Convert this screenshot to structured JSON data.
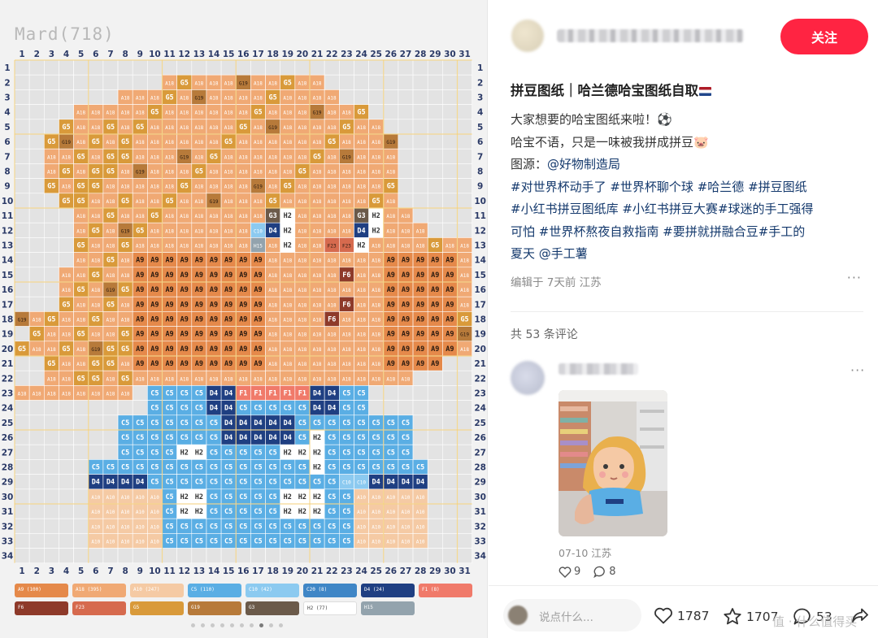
{
  "pattern": {
    "title": "Mard(718)",
    "columns": 31,
    "rows": 34,
    "legend_chips": [
      {
        "label": "A9 (100)",
        "color": "#e5894a"
      },
      {
        "label": "A18 (395)",
        "color": "#f0a974"
      },
      {
        "label": "A10 (247)",
        "color": "#f5caa4"
      },
      {
        "label": "C5 (110)",
        "color": "#5aaee4"
      },
      {
        "label": "C10 (42)",
        "color": "#8ccaf0"
      },
      {
        "label": "C20 (8)",
        "color": "#3f86c6"
      },
      {
        "label": "D4 (24)",
        "color": "#1f3f82"
      },
      {
        "label": "F1 (8)",
        "color": "#f07a6a"
      },
      {
        "label": "F6",
        "color": "#8e3a2a"
      },
      {
        "label": "F23",
        "color": "#d66a4e"
      },
      {
        "label": "G5",
        "color": "#d99a3a"
      },
      {
        "label": "G19",
        "color": "#b77a3a"
      },
      {
        "label": "G3",
        "color": "#6b5a4a"
      },
      {
        "label": "H2 (77)",
        "color": "#ffffff"
      },
      {
        "label": "H15",
        "color": "#93a3ad"
      }
    ],
    "page_dots": 10,
    "active_dot": 7
  },
  "author": {
    "follow_label": "关注"
  },
  "note": {
    "title": "拼豆图纸｜哈兰德哈宝图纸自取",
    "lines": [
      {
        "text": "大家想要的哈宝图纸来啦！⚽"
      },
      {
        "text": "哈宝不语，只是一味被我拼成拼豆🐷"
      },
      {
        "prefix": "图源：",
        "tag": "@好物制造局"
      }
    ],
    "hashtag_lines": [
      [
        "#对世界杯动手了",
        "#世界杯聊个球",
        "#哈兰德",
        "#拼豆图纸"
      ],
      [
        "#小红书拼豆图纸库",
        "#小红书拼豆大赛",
        "#球迷的手工强得"
      ],
      [
        "可怕",
        "#世界杯熬夜自救指南",
        "#要拼就拼融合豆",
        "#手工的"
      ],
      [
        "夏天",
        "@手工薯"
      ]
    ],
    "edited": "编辑于 7天前 江苏",
    "more": "···"
  },
  "comments": {
    "count_label": "共 53 条评论",
    "first": {
      "date_location": "07-10 江苏",
      "likes": "9",
      "replies": "8",
      "more": "···"
    }
  },
  "bottom_bar": {
    "placeholder": "说点什么...",
    "likes": "1787",
    "collects": "1707",
    "comments": "53"
  },
  "watermark": "值 · 什么值得买",
  "colors": {
    "accent": "#ff2442",
    "hashtag": "#13386c"
  }
}
